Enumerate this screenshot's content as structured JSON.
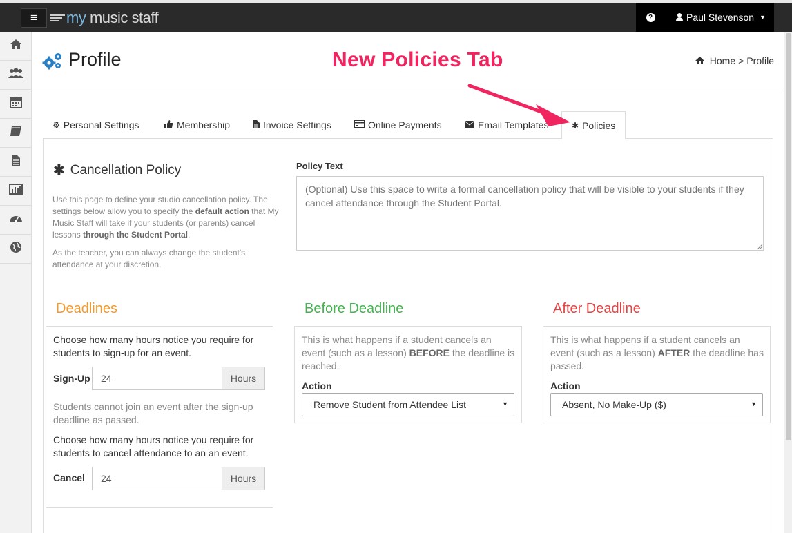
{
  "topbar": {
    "menu_icon": "hamburger-icon",
    "logo_prefix": "my",
    "logo_text": " music staff",
    "help_icon": "question-circle-icon",
    "user_name": "Paul Stevenson",
    "user_icon": "user-icon",
    "caret_icon": "caret-down-icon"
  },
  "sidebar": {
    "items": [
      {
        "icon": "home-icon",
        "glyph": "⌂"
      },
      {
        "icon": "users-icon",
        "glyph": "👥"
      },
      {
        "icon": "calendar-icon",
        "glyph": "▦"
      },
      {
        "icon": "book-icon",
        "glyph": "▰"
      },
      {
        "icon": "document-icon",
        "glyph": "▤"
      },
      {
        "icon": "bar-chart-icon",
        "glyph": "▥"
      },
      {
        "icon": "dashboard-icon",
        "glyph": "◔"
      },
      {
        "icon": "globe-icon",
        "glyph": "◍"
      }
    ]
  },
  "header": {
    "title": "Profile",
    "annotation": "New Policies Tab",
    "breadcrumb": {
      "home": "Home",
      "sep": ">",
      "current": "Profile"
    }
  },
  "tabs": [
    {
      "label": "Personal Settings",
      "icon": "cog-icon",
      "glyph": "⚙"
    },
    {
      "label": "Membership",
      "icon": "thumbs-up-icon",
      "glyph": "👍"
    },
    {
      "label": "Invoice Settings",
      "icon": "file-icon",
      "glyph": "▤"
    },
    {
      "label": "Online Payments",
      "icon": "credit-card-icon",
      "glyph": "▭"
    },
    {
      "label": "Email Templates",
      "icon": "envelope-icon",
      "glyph": "✉"
    },
    {
      "label": "Policies",
      "icon": "asterisk-icon",
      "glyph": "✱",
      "active": true
    }
  ],
  "cancellation": {
    "title": "Cancellation Policy",
    "desc_1": "Use this page to define your studio cancellation policy. The settings below allow you to specify the ",
    "desc_bold_1": "default action",
    "desc_2": " that My Music Staff will take if your students (or parents) cancel lessons ",
    "desc_bold_2": "through the Student Portal",
    "desc_3": ".",
    "desc_teacher": "As the teacher, you can always change the student's attendance at your discretion.",
    "policy_label": "Policy Text",
    "policy_placeholder": "(Optional) Use this space to write a formal cancellation policy that will be visible to your students if they cancel attendance through the Student Portal."
  },
  "deadlines": {
    "title": "Deadlines",
    "signup_help": "Choose how many hours notice you require for students to sign-up for an event.",
    "signup_label": "Sign-Up",
    "signup_value": "24",
    "signup_unit": "Hours",
    "signup_note": "Students cannot join an event after the sign-up deadline as passed.",
    "cancel_help": "Choose how many hours notice you require for students to cancel attendance to an an event.",
    "cancel_label": "Cancel",
    "cancel_value": "24",
    "cancel_unit": "Hours"
  },
  "before": {
    "title": "Before Deadline",
    "desc_1": "This is what happens if a student cancels an event (such as a lesson) ",
    "desc_bold": "BEFORE",
    "desc_2": " the deadline is reached.",
    "action_label": "Action",
    "action_value": "Remove Student from Attendee List"
  },
  "after": {
    "title": "After Deadline",
    "desc_1": "This is what happens if a student cancels an event (such as a lesson) ",
    "desc_bold": "AFTER",
    "desc_2": " the deadline has passed.",
    "action_label": "Action",
    "action_value": "Absent, No Make-Up ($)"
  },
  "colors": {
    "topbar": "#2a2a2a",
    "logo_blue": "#7ab7e0",
    "annotation": "#f0245f",
    "deadlines": "#f39a2a",
    "before": "#45b151",
    "after": "#e24444"
  }
}
